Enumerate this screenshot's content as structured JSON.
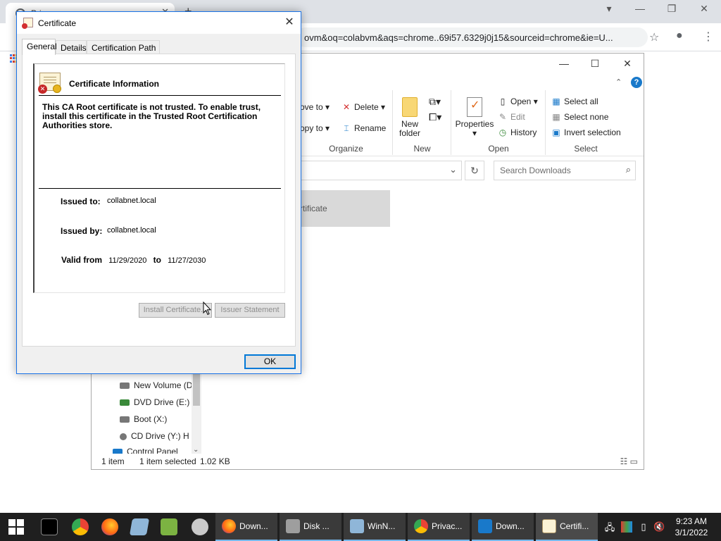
{
  "chrome": {
    "tab_title": "Privacy error",
    "address": "ovm&oq=colabvm&aqs=chrome..69i57.6329j0j15&sourceid=chrome&ie=U..."
  },
  "explorer": {
    "ribbon": {
      "organize": {
        "move_to": "ove to",
        "copy_to": "opy to",
        "delete": "Delete",
        "rename": "Rename",
        "label": "Organize"
      },
      "new": {
        "new_folder": "New folder",
        "label": "New"
      },
      "open": {
        "properties": "Properties",
        "open": "Open",
        "edit": "Edit",
        "history": "History",
        "label": "Open"
      },
      "select": {
        "select_all": "Select all",
        "select_none": "Select none",
        "invert_selection": "Invert selection",
        "label": "Select"
      }
    },
    "search_placeholder": "Search Downloads",
    "file_name_fragment": "rtificate",
    "nav_items": [
      "New Volume (D",
      "DVD Drive (E:) I",
      "Boot (X:)",
      "CD Drive (Y:) H",
      "Control Panel"
    ],
    "status": {
      "count": "1 item",
      "selected": "1 item selected",
      "size": "1.02 KB"
    }
  },
  "cert": {
    "title": "Certificate",
    "tabs": [
      "General",
      "Details",
      "Certification Path"
    ],
    "info_heading": "Certificate Information",
    "warning": "This CA Root certificate is not trusted. To enable trust, install this certificate in the Trusted Root Certification Authorities store.",
    "issued_to_label": "Issued to:",
    "issued_to": "collabnet.local",
    "issued_by_label": "Issued by:",
    "issued_by": "collabnet.local",
    "valid_from_label": "Valid from",
    "valid_from": "11/29/2020",
    "valid_to_label": "to",
    "valid_to": "11/27/2030",
    "install_button": "Install Certificate...",
    "issuer_button": "Issuer Statement",
    "ok_button": "OK"
  },
  "taskbar": {
    "tasks": [
      "Down...",
      "Disk ...",
      "WinN...",
      "Privac...",
      "Down...",
      "Certifi..."
    ],
    "time": "9:23 AM",
    "date": "3/1/2022"
  },
  "colors": {
    "accent": "#0078d7",
    "taskbar": "#1f1f1f"
  }
}
